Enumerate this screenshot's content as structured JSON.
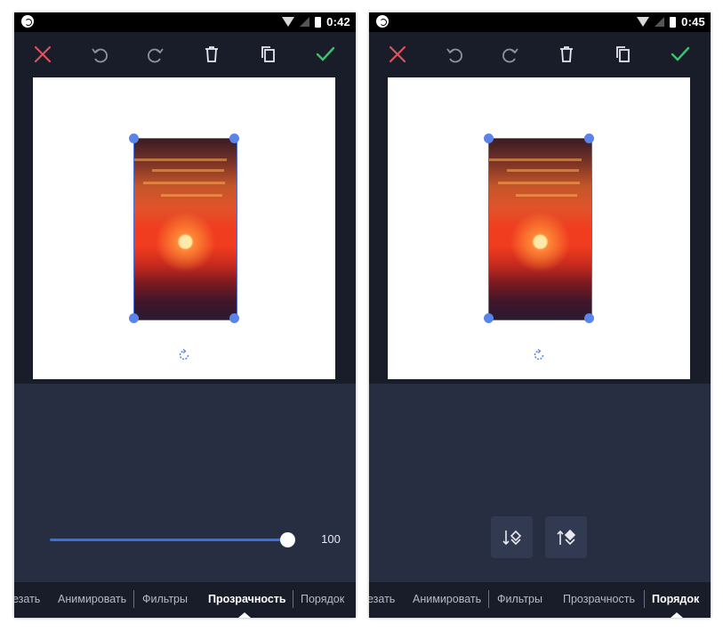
{
  "colors": {
    "accent": "#3d6ee0",
    "cancel": "#e0515a",
    "confirm": "#3cc46a",
    "panel": "#272e42",
    "toolbar": "#181d29"
  },
  "left": {
    "status_time": "0:42",
    "slider": {
      "value_label": "100",
      "level": 1.0
    },
    "tabs": {
      "cut": "езать",
      "animate": "Анимировать",
      "filters": "Фильтры",
      "opacity": "Прозрачность",
      "order": "Порядок",
      "active": "opacity"
    }
  },
  "right": {
    "status_time": "0:45",
    "order_buttons": {
      "send_backward_icon": "layer-down-icon",
      "bring_forward_icon": "layer-up-icon"
    },
    "tabs": {
      "cut": "езать",
      "animate": "Анимировать",
      "filters": "Фильтры",
      "opacity": "Прозрачность",
      "order": "Порядок",
      "active": "order"
    }
  },
  "toolbar_icons": [
    "close-icon",
    "undo-icon",
    "redo-icon",
    "delete-icon",
    "duplicate-icon",
    "check-icon"
  ]
}
